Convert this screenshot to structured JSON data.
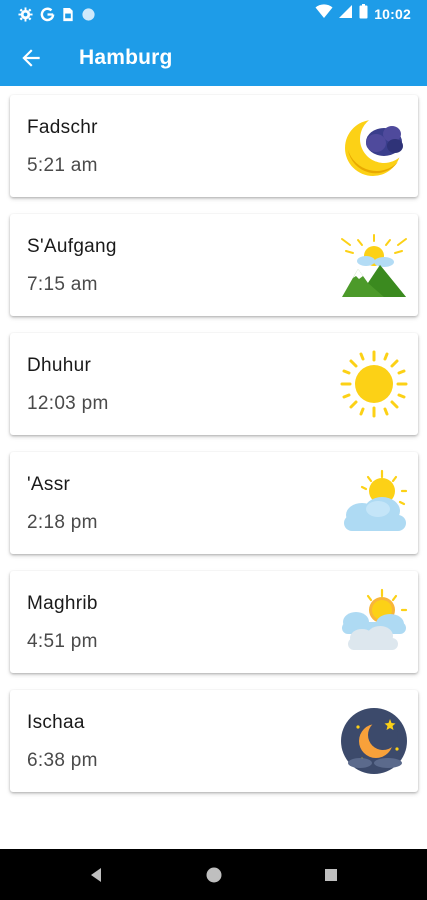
{
  "status_bar": {
    "time": "10:02",
    "left_icons": [
      "gear-icon",
      "google-icon",
      "sim-card-icon",
      "circle-icon"
    ],
    "right_icons": [
      "wifi-icon",
      "cell-signal-icon",
      "battery-icon"
    ]
  },
  "app_bar": {
    "title": "Hamburg",
    "back_icon": "arrow-left-icon"
  },
  "prayers": [
    {
      "name": "Fadschr",
      "time": "5:21 am",
      "icon": "crescent-moon-cloud-icon"
    },
    {
      "name": "S'Aufgang",
      "time": "7:15 am",
      "icon": "sunrise-mountains-icon"
    },
    {
      "name": "Dhuhur",
      "time": "12:03 pm",
      "icon": "sun-icon"
    },
    {
      "name": "'Assr",
      "time": "2:18 pm",
      "icon": "sun-behind-cloud-icon"
    },
    {
      "name": "Maghrib",
      "time": "4:51 pm",
      "icon": "sun-clouds-icon"
    },
    {
      "name": "Ischaa",
      "time": "6:38 pm",
      "icon": "night-moon-icon"
    }
  ],
  "colors": {
    "primary": "#1e9ce8",
    "sun": "#fcd116",
    "night": "#3c4a6b"
  },
  "nav_bar": {
    "buttons": [
      "back-triangle-icon",
      "home-circle-icon",
      "recents-square-icon"
    ]
  }
}
